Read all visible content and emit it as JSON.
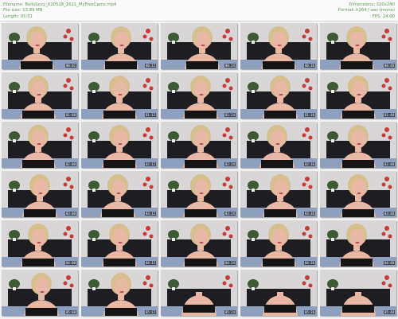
{
  "header": {
    "filename": "Filename: BelloSexy_020518_1621_MyFreeCams.mp4",
    "filesize": "File size: 13.89 MB",
    "length": "Length: 05:51",
    "dimensions": "Dimensions: 320x240",
    "format": "Format: h264 / aac (mono)",
    "fps": "FPS: 24.00"
  },
  "colors": {
    "header_text": "#5e9a54",
    "wall": "#d9d6d8",
    "headboard": "#1d1d22",
    "bed": "#8f9fbe",
    "hair": "#d6bf8e",
    "skin": "#e8b8a4",
    "top": "#151515",
    "flower": "#c83a3a",
    "plant": "#3e5a35"
  },
  "thumbnails": [
    {
      "ts": "00:01",
      "icon": "video-frame-thumbnail"
    },
    {
      "ts": "00:12",
      "icon": "video-frame-thumbnail"
    },
    {
      "ts": "00:24",
      "icon": "video-frame-thumbnail"
    },
    {
      "ts": "00:36",
      "icon": "video-frame-thumbnail"
    },
    {
      "ts": "00:48",
      "icon": "video-frame-thumbnail"
    },
    {
      "ts": "01:00",
      "icon": "video-frame-thumbnail"
    },
    {
      "ts": "01:12",
      "icon": "video-frame-thumbnail"
    },
    {
      "ts": "01:24",
      "icon": "video-frame-thumbnail"
    },
    {
      "ts": "01:36",
      "icon": "video-frame-thumbnail"
    },
    {
      "ts": "01:48",
      "icon": "video-frame-thumbnail"
    },
    {
      "ts": "02:00",
      "icon": "video-frame-thumbnail"
    },
    {
      "ts": "02:12",
      "icon": "video-frame-thumbnail"
    },
    {
      "ts": "02:24",
      "icon": "video-frame-thumbnail"
    },
    {
      "ts": "02:36",
      "icon": "video-frame-thumbnail"
    },
    {
      "ts": "02:48",
      "icon": "video-frame-thumbnail"
    },
    {
      "ts": "03:00",
      "icon": "video-frame-thumbnail"
    },
    {
      "ts": "03:12",
      "icon": "video-frame-thumbnail"
    },
    {
      "ts": "03:24",
      "icon": "video-frame-thumbnail"
    },
    {
      "ts": "03:36",
      "icon": "video-frame-thumbnail"
    },
    {
      "ts": "03:48",
      "icon": "video-frame-thumbnail"
    },
    {
      "ts": "04:00",
      "icon": "video-frame-thumbnail"
    },
    {
      "ts": "04:12",
      "icon": "video-frame-thumbnail"
    },
    {
      "ts": "04:24",
      "icon": "video-frame-thumbnail"
    },
    {
      "ts": "04:36",
      "icon": "video-frame-thumbnail"
    },
    {
      "ts": "04:48",
      "icon": "video-frame-thumbnail"
    },
    {
      "ts": "05:00",
      "icon": "video-frame-thumbnail"
    },
    {
      "ts": "05:12",
      "icon": "video-frame-thumbnail"
    },
    {
      "ts": "05:24",
      "icon": "video-frame-thumbnail"
    },
    {
      "ts": "05:36",
      "icon": "video-frame-thumbnail"
    },
    {
      "ts": "05:48",
      "icon": "video-frame-thumbnail"
    }
  ]
}
